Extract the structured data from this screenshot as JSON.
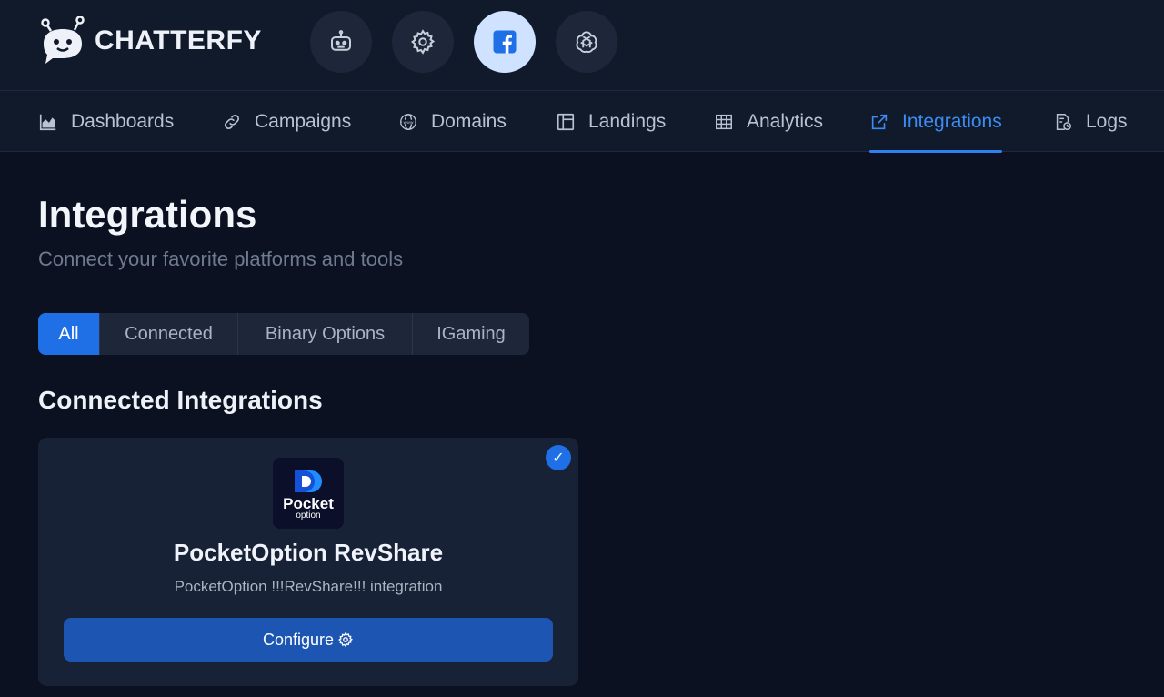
{
  "app": {
    "brand_name": "CHATTERFY",
    "accent_color": "#1f6fe6"
  },
  "top_buttons": [
    {
      "icon": "robot-icon",
      "active": false
    },
    {
      "icon": "gear-icon",
      "active": false
    },
    {
      "icon": "facebook-icon",
      "active": true
    },
    {
      "icon": "openai-icon",
      "active": false
    }
  ],
  "nav": {
    "items": [
      {
        "label": "Dashboards",
        "icon": "chart-area-icon"
      },
      {
        "label": "Campaigns",
        "icon": "link-icon"
      },
      {
        "label": "Domains",
        "icon": "globe-www-icon"
      },
      {
        "label": "Landings",
        "icon": "layout-icon"
      },
      {
        "label": "Analytics",
        "icon": "table-icon"
      },
      {
        "label": "Integrations",
        "icon": "external-link-icon",
        "active": true
      },
      {
        "label": "Logs",
        "icon": "file-clock-icon"
      }
    ]
  },
  "page": {
    "title": "Integrations",
    "subtitle": "Connect your favorite platforms and tools"
  },
  "filters": {
    "tabs": [
      {
        "label": "All",
        "active": true
      },
      {
        "label": "Connected"
      },
      {
        "label": "Binary Options"
      },
      {
        "label": "IGaming"
      }
    ]
  },
  "section": {
    "title": "Connected Integrations"
  },
  "integration": {
    "logo_word": "Pocket",
    "logo_sub": "option",
    "name": "PocketOption RevShare",
    "description": "PocketOption !!!RevShare!!! integration",
    "status_mark": "✓",
    "connected": true,
    "configure_label": "Configure"
  }
}
